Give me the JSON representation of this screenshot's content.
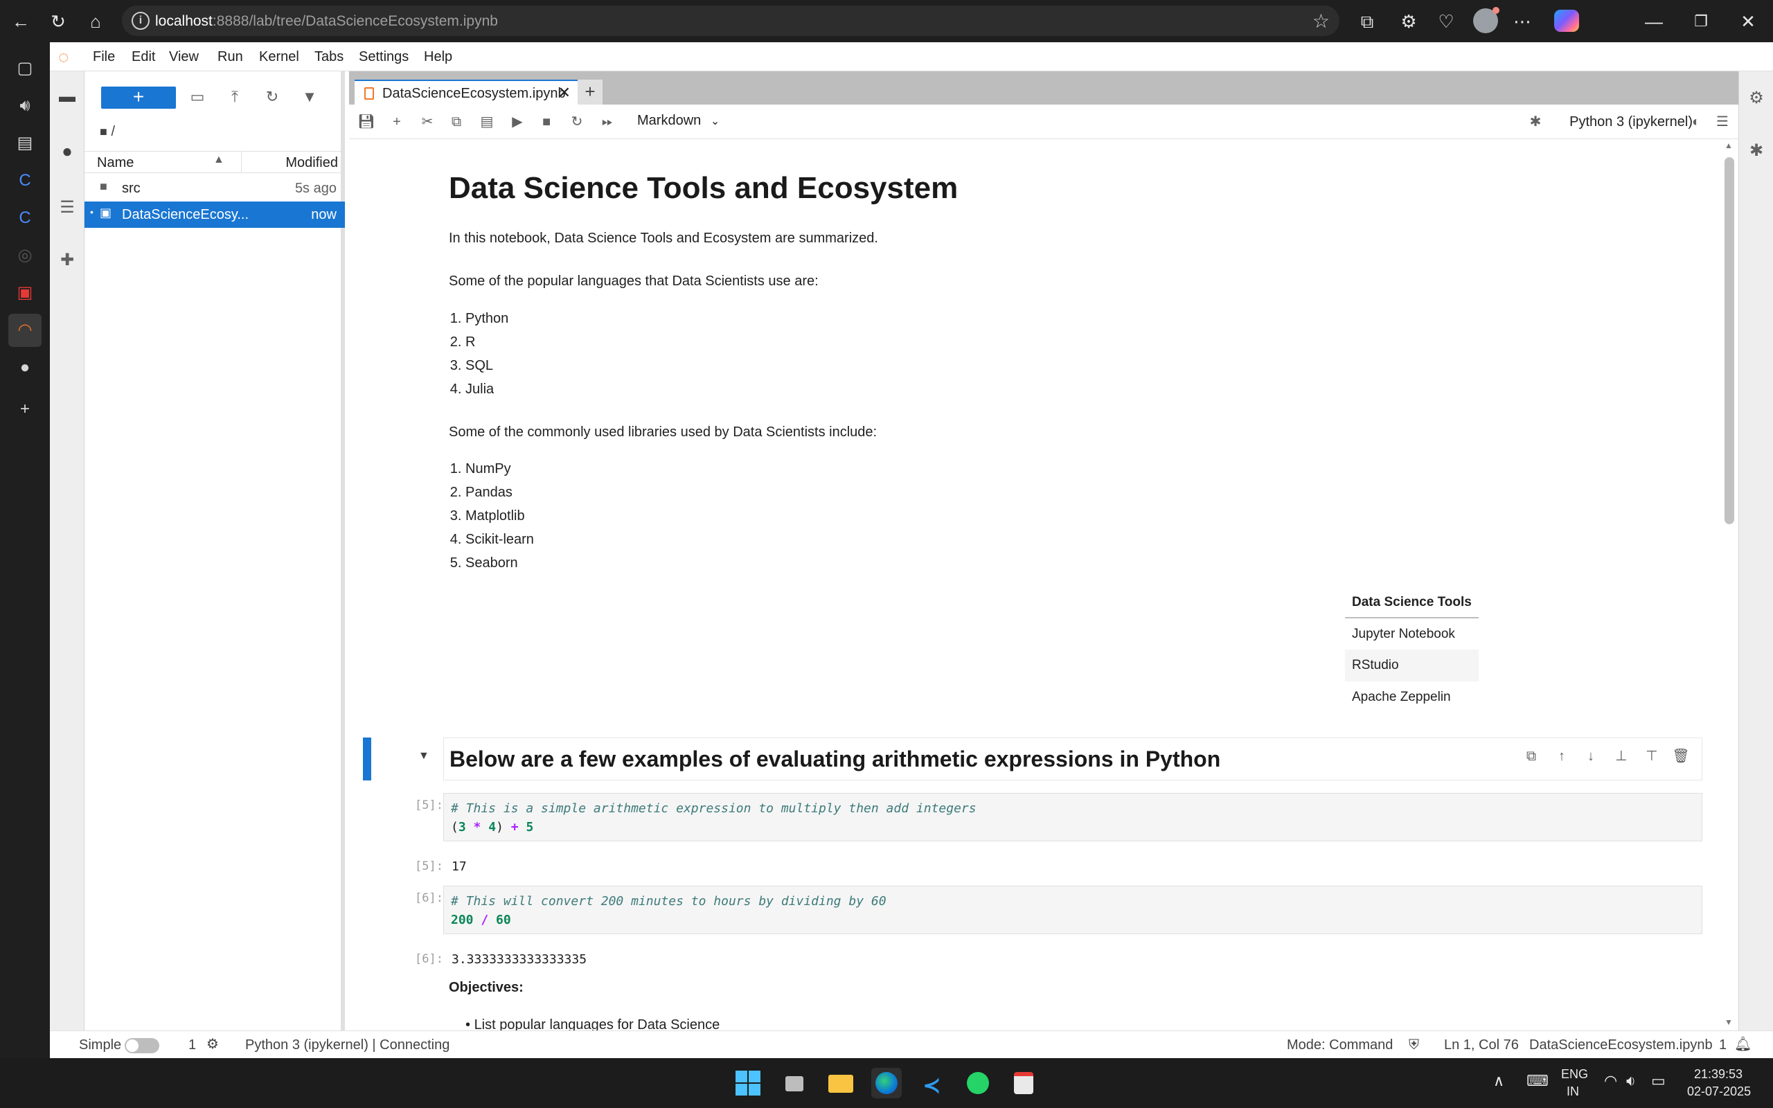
{
  "browser": {
    "url_host": "localhost",
    "url_path": ":8888/lab/tree/DataScienceEcosystem.ipynb"
  },
  "menu": [
    "File",
    "Edit",
    "View",
    "Run",
    "Kernel",
    "Tabs",
    "Settings",
    "Help"
  ],
  "filebrowser": {
    "new_label": "+",
    "breadcrumb": "/",
    "col_name": "Name",
    "col_modified": "Modified",
    "rows": [
      {
        "name": "src",
        "modified": "5s ago"
      },
      {
        "name": "DataScienceEcosy...",
        "modified": "now"
      }
    ]
  },
  "notebook": {
    "tab_title": "DataScienceEcosystem.ipynb",
    "cell_type": "Markdown",
    "kernel": "Python 3 (ipykernel)",
    "h1": "Data Science Tools and Ecosystem",
    "intro": "In this notebook, Data Science Tools and Ecosystem are summarized.",
    "languages_intro": "Some of the popular languages that Data Scientists use are:",
    "languages": [
      "Python",
      "R",
      "SQL",
      "Julia"
    ],
    "libraries_intro": "Some of the commonly used libraries used by Data Scientists include:",
    "libraries": [
      "NumPy",
      "Pandas",
      "Matplotlib",
      "Scikit-learn",
      "Seaborn"
    ],
    "table": {
      "header": "Data Science Tools",
      "rows": [
        "Jupyter Notebook",
        "RStudio",
        "Apache Zeppelin"
      ]
    },
    "h2": "Below are a few examples of evaluating arithmetic expressions in Python",
    "cells": [
      {
        "prompt": "[5]:",
        "comment": "# This is a simple arithmetic expression to multiply then add integers",
        "output_prompt": "[5]:",
        "output": "17"
      },
      {
        "prompt": "[6]:",
        "comment": "# This will convert 200 minutes to hours by dividing by 60",
        "output_prompt": "[6]:",
        "output": "3.3333333333333335"
      }
    ],
    "objectives_title": "Objectives:",
    "objectives_first": "List popular languages for Data Science"
  },
  "statusbar": {
    "mode_label": "Simple",
    "terminals": "1",
    "kernel_status": "Python 3 (ipykernel) | Connecting",
    "mode": "Mode: Command",
    "cursor": "Ln 1, Col 76",
    "file": "DataScienceEcosystem.ipynb",
    "notifications": "1"
  },
  "taskbar": {
    "lang": "ENG",
    "region": "IN",
    "time": "21:39:53",
    "date": "02-07-2025"
  },
  "colors": {
    "accent": "#1976d2",
    "jupyter_orange": "#f37726"
  }
}
